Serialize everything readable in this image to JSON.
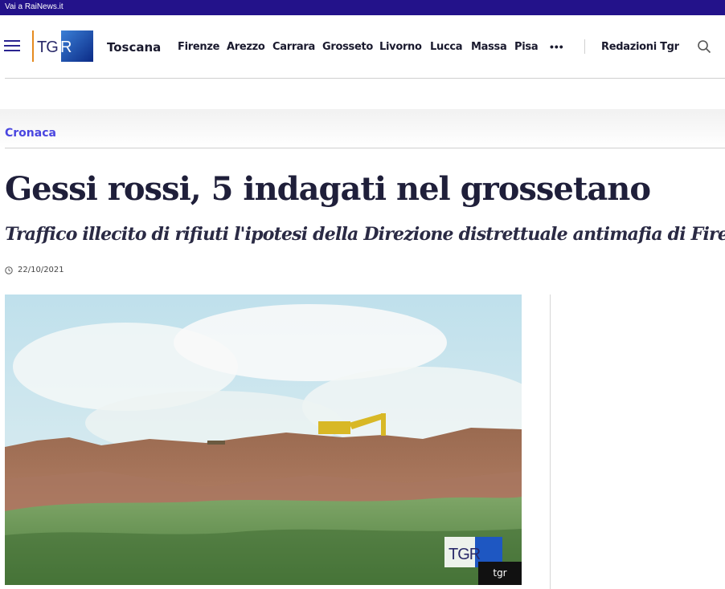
{
  "topbar": {
    "link": "Vai a RaiNews.it"
  },
  "header": {
    "region": "Toscana",
    "nav": [
      "Firenze",
      "Arezzo",
      "Carrara",
      "Grosseto",
      "Livorno",
      "Lucca",
      "Massa",
      "Pisa"
    ],
    "more": "•••",
    "redazioni": "Redazioni Tgr",
    "logo_text": "TGR"
  },
  "article": {
    "section": "Cronaca",
    "title": "Gessi rossi, 5 indagati nel grossetano",
    "subtitle": "Traffico illecito di rifiuti l'ipotesi della Direzione distrettuale antimafia di Firenze",
    "date": "22/10/2021",
    "image_caption": "tgr",
    "image_logo": "TGR"
  },
  "colors": {
    "brand": "#23128a",
    "accent": "#4a46e0",
    "text": "#1f1f3a"
  },
  "icons": [
    "hamburger-icon",
    "search-icon",
    "clock-icon"
  ]
}
